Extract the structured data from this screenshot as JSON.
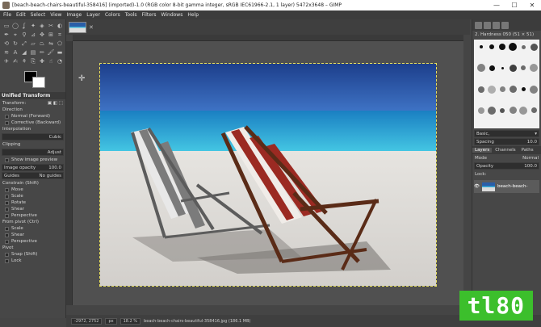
{
  "window": {
    "title": "[beach-beach-chairs-beautiful-358416] (imported)-1.0 (RGB color 8-bit gamma integer, sRGB IEC61966-2.1, 1 layer) 5472x3648 – GIMP",
    "minimize": "—",
    "maximize": "☐",
    "close": "✕"
  },
  "menu": [
    "File",
    "Edit",
    "Select",
    "View",
    "Image",
    "Layer",
    "Colors",
    "Tools",
    "Filters",
    "Windows",
    "Help"
  ],
  "tool_options": {
    "title": "Unified Transform",
    "transform_label": "Transform:",
    "direction_label": "Direction",
    "direction_normal": "Normal (Forward)",
    "direction_corrective": "Corrective (Backward)",
    "interpolation_label": "Interpolation",
    "interpolation_value": "Cubic",
    "clipping_label": "Clipping",
    "clipping_value": "Adjust",
    "show_preview": "Show image preview",
    "image_opacity_label": "Image opacity",
    "image_opacity_value": "100.0",
    "guides_label": "Guides",
    "guides_value": "No guides",
    "constrain_label": "Constrain (Shift)",
    "constrain_items": [
      "Move",
      "Scale",
      "Rotate",
      "Shear",
      "Perspective"
    ],
    "from_pivot_label": "From pivot  (Ctrl)",
    "from_pivot_items": [
      "Scale",
      "Shear",
      "Perspective"
    ],
    "pivot_label": "Pivot",
    "pivot_items": [
      "Snap (Shift)",
      "Lock"
    ]
  },
  "statusbar": {
    "coords": "-2972, 2752",
    "unit": "px",
    "zoom": "18.2 %",
    "filename": "beach-beach-chairs-beautiful-358416.jpg (186.1 MB)"
  },
  "right_dock": {
    "brush_name": "2. Hardness 050 (51 × 51)",
    "preset_label": "Basic,",
    "spacing_label": "Spacing",
    "spacing_value": "10.0",
    "layer_tabs": [
      "Layers",
      "Channels",
      "Paths"
    ],
    "mode_label": "Mode",
    "mode_value": "Normal",
    "opacity_label": "Opacity",
    "opacity_value": "100.0",
    "lock_label": "Lock:",
    "layer_name": "beach-beach-"
  },
  "watermark": "tl80",
  "colors": {
    "foreground": "#000000",
    "background": "#ffffff",
    "selection": "#e8e060",
    "watermark_bg": "#3cbf2c"
  }
}
